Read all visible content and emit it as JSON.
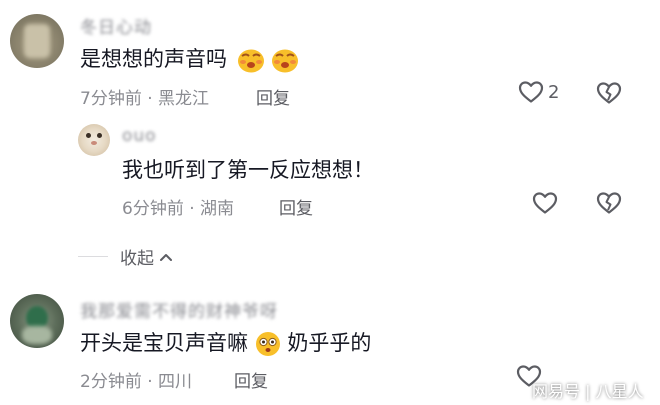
{
  "comments": [
    {
      "username": "冬日心动",
      "text": "是想想的声音吗",
      "time": "7分钟前",
      "location": "黑龙江",
      "reply_label": "回复",
      "like_count": "2"
    },
    {
      "username": "ouo",
      "text": "我也听到了第一反应想想！",
      "time": "6分钟前",
      "location": "湖南",
      "reply_label": "回复"
    },
    {
      "username": "我那爱需不得的财神爷呀",
      "text_before": "开头是宝贝声音嘛",
      "text_after": "奶乎乎的",
      "time": "2分钟前",
      "location": "四川",
      "reply_label": "回复"
    }
  ],
  "collapse_label": "收起",
  "meta_separator": "·",
  "watermark": "网易号 | 八星人",
  "colors": {
    "text_primary": "#161823",
    "text_secondary": "#8a8b91",
    "emoji_yellow": "#f8bf2a",
    "icon_stroke": "#5c5d63"
  }
}
